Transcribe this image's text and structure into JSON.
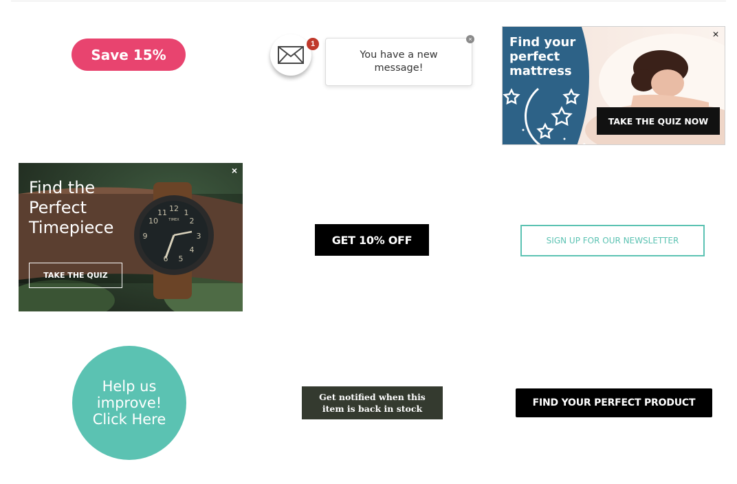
{
  "save_button": {
    "label": "Save 15%",
    "color": "#e8446f"
  },
  "message_notification": {
    "badge_count": "1",
    "message": "You have a new message!",
    "close_symbol": "×",
    "badge_color": "#c0392b"
  },
  "mattress_ad": {
    "title": "Find your perfect mattress",
    "cta_label": "TAKE THE QUIZ NOW",
    "close_symbol": "×",
    "panel_color": "#2d6287"
  },
  "watch_ad": {
    "title": "Find the Perfect Timepiece",
    "cta_label": "TAKE THE QUIZ",
    "close_symbol": "×",
    "watch_brand": "TIMEX"
  },
  "discount_button": {
    "label": "GET 10% OFF"
  },
  "newsletter_button": {
    "label": "SIGN UP FOR OUR NEWSLETTER",
    "color": "#5bc2b2"
  },
  "feedback_circle": {
    "label": "Help us improve! Click Here",
    "color": "#5bc2b2"
  },
  "restock_button": {
    "label": "Get notified when this item is back in stock",
    "color": "#343a2f"
  },
  "product_button": {
    "label": "FIND YOUR PERFECT PRODUCT"
  },
  "icons": [
    "envelope-icon",
    "close-icon",
    "moon-icon",
    "star-icon"
  ]
}
